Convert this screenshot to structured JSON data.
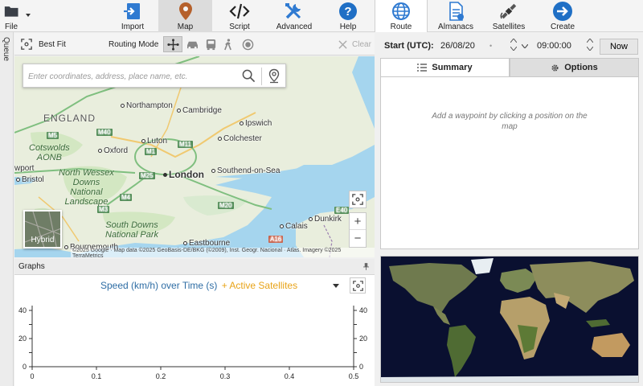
{
  "ribbon": {
    "file_label": "File",
    "items": [
      {
        "label": "Import",
        "icon": "import-icon"
      },
      {
        "label": "Map",
        "icon": "map-pin-icon"
      },
      {
        "label": "Script",
        "icon": "code-icon"
      },
      {
        "label": "Advanced",
        "icon": "tools-icon"
      },
      {
        "label": "Help",
        "icon": "help-icon"
      }
    ],
    "right_items": [
      {
        "label": "Route",
        "icon": "globe-route-icon"
      },
      {
        "label": "Almanacs",
        "icon": "document-icon"
      },
      {
        "label": "Satellites",
        "icon": "satellite-icon"
      },
      {
        "label": "Create",
        "icon": "arrow-right-icon"
      }
    ]
  },
  "queue_label": "Queue",
  "map_toolbar": {
    "best_fit_label": "Best Fit",
    "routing_mode_label": "Routing Mode",
    "clear_label": "Clear"
  },
  "map": {
    "search_placeholder": "Enter coordinates, address, place name, etc.",
    "hybrid_label": "Hybrid",
    "attribution": "©2025 Google · Map data ©2025 GeoBasis-DE/BKG (©2009), Inst. Geogr. Nacional · Atlas. Imagery ©2025 TerraMetrics",
    "country": "ENGLAND",
    "places": {
      "northampton": "Northampton",
      "cambridge": "Cambridge",
      "ipswich": "Ipswich",
      "luton": "Luton",
      "colchester": "Colchester",
      "oxford": "Oxford",
      "london": "London",
      "southend": "Southend-on-Sea",
      "bristol": "Bristol",
      "newport": "wport",
      "dunkirk": "Dunkirk",
      "calais": "Calais",
      "eastbourne": "Eastbourne",
      "bournemouth": "Bournemouth"
    },
    "regions": {
      "cotswolds": "Cotswolds\nAONB",
      "north_wessex": "North Wessex\nDowns\nNational\nLandscape",
      "south_downs": "South Downs\nNational Park"
    },
    "roads": {
      "m5": "M5",
      "m40": "M40",
      "m1": "M1",
      "m11": "M11",
      "m25": "M25",
      "m4": "M4",
      "m3": "M3",
      "m20": "M20",
      "e40": "E40",
      "a16": "A16"
    }
  },
  "graphs": {
    "header_label": "Graphs",
    "title_series1": "Speed (km/h) over Time (s)",
    "title_separator": "+",
    "title_series2": "Active Satellites"
  },
  "chart_data": {
    "type": "line",
    "title": "Speed (km/h) over Time (s) + Active Satellites",
    "xlabel": "",
    "ylabel": "",
    "xlim": [
      0,
      0.5
    ],
    "ylim": [
      0,
      40
    ],
    "y2lim": [
      0,
      40
    ],
    "x_ticks": [
      "0",
      "0.1",
      "0.2",
      "0.3",
      "0.4",
      "0.5"
    ],
    "y_ticks": [
      "0",
      "10",
      "20",
      "30",
      "40"
    ],
    "y_tick_labels_shown": [
      "0",
      "20",
      "40"
    ],
    "series": [
      {
        "name": "Speed (km/h) over Time (s)",
        "color": "#2e6da4",
        "values": []
      },
      {
        "name": "Active Satellites",
        "color": "#e8a317",
        "values": []
      }
    ]
  },
  "right_panel": {
    "start_label": "Start (UTC):",
    "date_value": "26/08/20",
    "time_value": "09:00:00",
    "now_label": "Now",
    "tab_summary": "Summary",
    "tab_options": "Options",
    "hint": "Add a waypoint by clicking a position on the map"
  },
  "colors": {
    "speed_series": "#2e6da4",
    "satellite_series": "#e8a317",
    "map_pin": "#b5602b",
    "help_blue": "#1f6fc5"
  }
}
